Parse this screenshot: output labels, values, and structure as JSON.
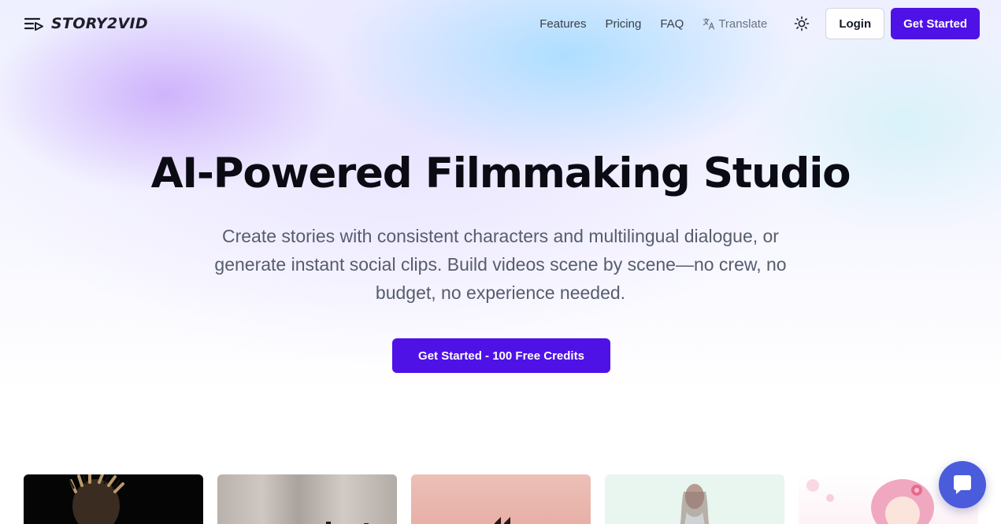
{
  "brand": {
    "name": "STORY2VID",
    "icon": "menu-play-icon"
  },
  "nav": {
    "links": [
      "Features",
      "Pricing",
      "FAQ"
    ],
    "translate_label": "Translate",
    "translate_icon": "translate-icon",
    "theme_icon": "sun-icon",
    "login_label": "Login",
    "get_started_label": "Get Started"
  },
  "hero": {
    "title": "AI-Powered Filmmaking Studio",
    "subtitle": "Create stories with consistent characters and multilingual dialogue, or generate instant social clips. Build videos scene by scene—no crew, no budget, no experience needed.",
    "cta_label": "Get Started - 100 Free Credits"
  },
  "gallery": {
    "card_count": 5
  },
  "chat": {
    "icon": "chat-bubble-icon"
  },
  "colors": {
    "primary": "#4f12e6",
    "chat": "#4a5bdc",
    "heading": "#0b0b14",
    "body": "#555d6e"
  }
}
